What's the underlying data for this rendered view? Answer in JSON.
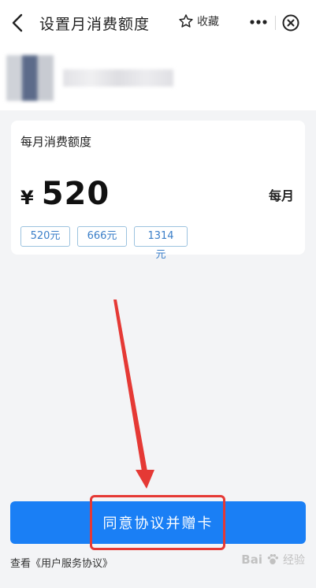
{
  "header": {
    "title": "设置月消费额度",
    "favorite_label": "收藏",
    "back_icon": "chevron-left-icon",
    "favorite_icon": "star-outline-icon",
    "more_icon": "more-dots-icon",
    "close_icon": "close-circle-icon"
  },
  "card": {
    "label": "每月消费额度",
    "currency": "¥",
    "amount": "520",
    "period": "每月",
    "options": [
      "520元",
      "666元",
      "1314元"
    ]
  },
  "footer": {
    "primary_button": "同意协议并赠卡",
    "agreement_prefix": "查看",
    "agreement_link": "《用户服务协议》"
  },
  "watermark": {
    "brand": "Bai",
    "suffix": "经验"
  },
  "colors": {
    "primary": "#1a7ff5",
    "chip_text": "#3a7ec8",
    "annotation": "#e53935"
  }
}
